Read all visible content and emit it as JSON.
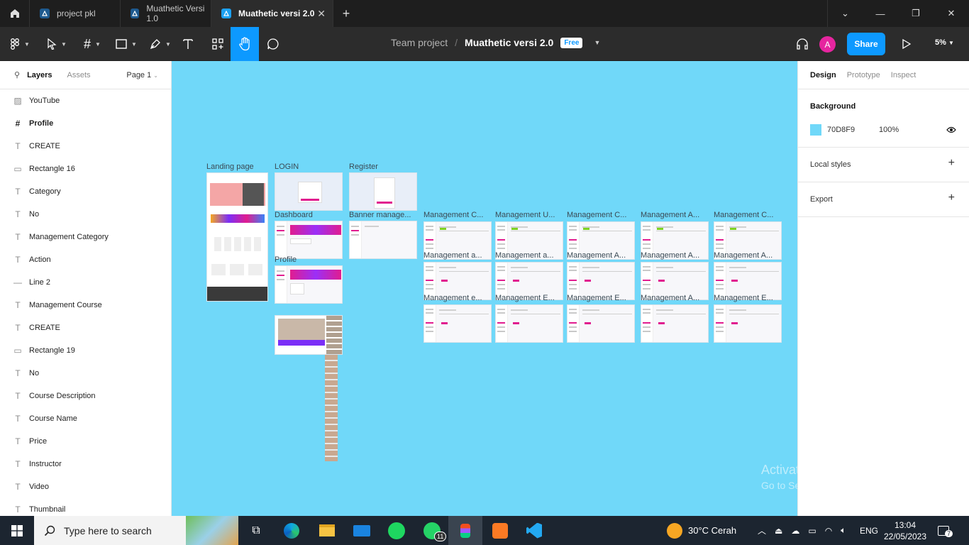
{
  "tabs": [
    {
      "label": "project pkl",
      "active": false
    },
    {
      "label": "Muathetic Versi 1.0",
      "active": false
    },
    {
      "label": "Muathetic versi 2.0",
      "active": true
    }
  ],
  "toolbar": {
    "team": "Team project",
    "separator": "/",
    "file_name": "Muathetic versi 2.0",
    "plan_badge": "Free",
    "avatar_initial": "A",
    "share_label": "Share",
    "zoom": "5%"
  },
  "left_panel": {
    "tab_layers": "Layers",
    "tab_assets": "Assets",
    "page": "Page 1",
    "layers": [
      {
        "name": "YouTube",
        "icon": "image-icon"
      },
      {
        "name": "Profile",
        "icon": "frame-icon"
      },
      {
        "name": "CREATE",
        "icon": "text-icon"
      },
      {
        "name": "Rectangle 16",
        "icon": "rectangle-icon"
      },
      {
        "name": "Category",
        "icon": "text-icon"
      },
      {
        "name": "No",
        "icon": "text-icon"
      },
      {
        "name": "Management Category",
        "icon": "text-icon"
      },
      {
        "name": "Action",
        "icon": "text-icon"
      },
      {
        "name": "Line 2",
        "icon": "line-icon"
      },
      {
        "name": "Management Course",
        "icon": "text-icon"
      },
      {
        "name": "CREATE",
        "icon": "text-icon"
      },
      {
        "name": "Rectangle 19",
        "icon": "rectangle-icon"
      },
      {
        "name": "No",
        "icon": "text-icon"
      },
      {
        "name": "Course Description",
        "icon": "text-icon"
      },
      {
        "name": "Course Name",
        "icon": "text-icon"
      },
      {
        "name": "Price",
        "icon": "text-icon"
      },
      {
        "name": "Instructor",
        "icon": "text-icon"
      },
      {
        "name": "Video",
        "icon": "text-icon"
      },
      {
        "name": "Thumbnail",
        "icon": "text-icon"
      }
    ]
  },
  "canvas": {
    "background": "#70D8F9",
    "frames": {
      "landing": "Landing page",
      "login": "LOGIN",
      "register": "Register",
      "dashboard": "Dashboard",
      "banner": "Banner manage...",
      "profile": "Profile",
      "m1": "Management C...",
      "m2": "Management U...",
      "m3": "Management C...",
      "m4": "Management A...",
      "m5": "Management C...",
      "m6": "Management a...",
      "m7": "Management a...",
      "m8": "Management A...",
      "m9": "Management A...",
      "m10": "Management A...",
      "m11": "Management e...",
      "m12": "Management E...",
      "m13": "Management E...",
      "m14": "Management A...",
      "m15": "Management E..."
    },
    "watermark_title": "Activate Windows",
    "watermark_sub": "Go to Settings to activate Windows.",
    "help": "?"
  },
  "right_panel": {
    "tab_design": "Design",
    "tab_prototype": "Prototype",
    "tab_inspect": "Inspect",
    "background_title": "Background",
    "bg_hex": "70D8F9",
    "bg_opacity": "100%",
    "local_styles": "Local styles",
    "export": "Export"
  },
  "taskbar": {
    "search_placeholder": "Type here to search",
    "whatsapp_badge": "11",
    "weather": "30°C  Cerah",
    "lang": "ENG",
    "time": "13:04",
    "date": "22/05/2023",
    "notif_count": "7"
  }
}
